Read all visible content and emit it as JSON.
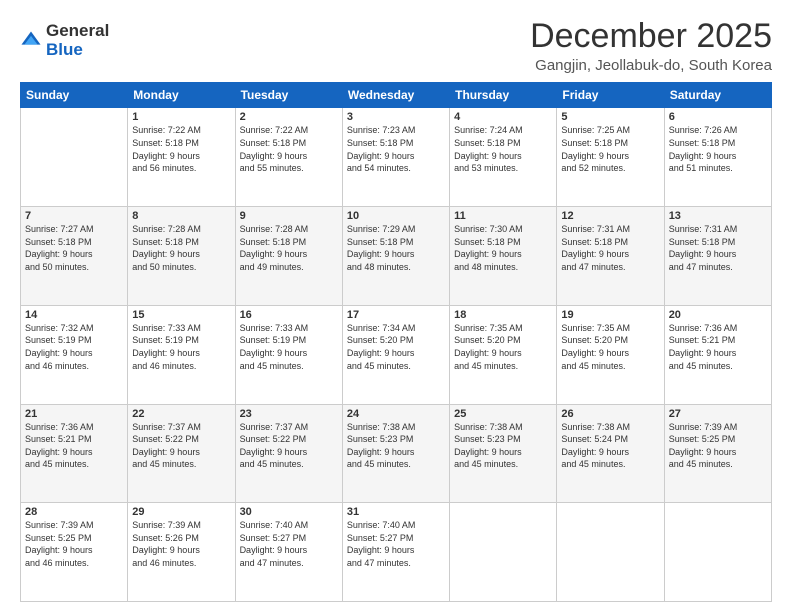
{
  "logo": {
    "general": "General",
    "blue": "Blue"
  },
  "title": "December 2025",
  "subtitle": "Gangjin, Jeollabuk-do, South Korea",
  "days_header": [
    "Sunday",
    "Monday",
    "Tuesday",
    "Wednesday",
    "Thursday",
    "Friday",
    "Saturday"
  ],
  "weeks": [
    [
      {
        "day": "",
        "content": ""
      },
      {
        "day": "1",
        "content": "Sunrise: 7:22 AM\nSunset: 5:18 PM\nDaylight: 9 hours\nand 56 minutes."
      },
      {
        "day": "2",
        "content": "Sunrise: 7:22 AM\nSunset: 5:18 PM\nDaylight: 9 hours\nand 55 minutes."
      },
      {
        "day": "3",
        "content": "Sunrise: 7:23 AM\nSunset: 5:18 PM\nDaylight: 9 hours\nand 54 minutes."
      },
      {
        "day": "4",
        "content": "Sunrise: 7:24 AM\nSunset: 5:18 PM\nDaylight: 9 hours\nand 53 minutes."
      },
      {
        "day": "5",
        "content": "Sunrise: 7:25 AM\nSunset: 5:18 PM\nDaylight: 9 hours\nand 52 minutes."
      },
      {
        "day": "6",
        "content": "Sunrise: 7:26 AM\nSunset: 5:18 PM\nDaylight: 9 hours\nand 51 minutes."
      }
    ],
    [
      {
        "day": "7",
        "content": "Sunrise: 7:27 AM\nSunset: 5:18 PM\nDaylight: 9 hours\nand 50 minutes."
      },
      {
        "day": "8",
        "content": "Sunrise: 7:28 AM\nSunset: 5:18 PM\nDaylight: 9 hours\nand 50 minutes."
      },
      {
        "day": "9",
        "content": "Sunrise: 7:28 AM\nSunset: 5:18 PM\nDaylight: 9 hours\nand 49 minutes."
      },
      {
        "day": "10",
        "content": "Sunrise: 7:29 AM\nSunset: 5:18 PM\nDaylight: 9 hours\nand 48 minutes."
      },
      {
        "day": "11",
        "content": "Sunrise: 7:30 AM\nSunset: 5:18 PM\nDaylight: 9 hours\nand 48 minutes."
      },
      {
        "day": "12",
        "content": "Sunrise: 7:31 AM\nSunset: 5:18 PM\nDaylight: 9 hours\nand 47 minutes."
      },
      {
        "day": "13",
        "content": "Sunrise: 7:31 AM\nSunset: 5:18 PM\nDaylight: 9 hours\nand 47 minutes."
      }
    ],
    [
      {
        "day": "14",
        "content": "Sunrise: 7:32 AM\nSunset: 5:19 PM\nDaylight: 9 hours\nand 46 minutes."
      },
      {
        "day": "15",
        "content": "Sunrise: 7:33 AM\nSunset: 5:19 PM\nDaylight: 9 hours\nand 46 minutes."
      },
      {
        "day": "16",
        "content": "Sunrise: 7:33 AM\nSunset: 5:19 PM\nDaylight: 9 hours\nand 45 minutes."
      },
      {
        "day": "17",
        "content": "Sunrise: 7:34 AM\nSunset: 5:20 PM\nDaylight: 9 hours\nand 45 minutes."
      },
      {
        "day": "18",
        "content": "Sunrise: 7:35 AM\nSunset: 5:20 PM\nDaylight: 9 hours\nand 45 minutes."
      },
      {
        "day": "19",
        "content": "Sunrise: 7:35 AM\nSunset: 5:20 PM\nDaylight: 9 hours\nand 45 minutes."
      },
      {
        "day": "20",
        "content": "Sunrise: 7:36 AM\nSunset: 5:21 PM\nDaylight: 9 hours\nand 45 minutes."
      }
    ],
    [
      {
        "day": "21",
        "content": "Sunrise: 7:36 AM\nSunset: 5:21 PM\nDaylight: 9 hours\nand 45 minutes."
      },
      {
        "day": "22",
        "content": "Sunrise: 7:37 AM\nSunset: 5:22 PM\nDaylight: 9 hours\nand 45 minutes."
      },
      {
        "day": "23",
        "content": "Sunrise: 7:37 AM\nSunset: 5:22 PM\nDaylight: 9 hours\nand 45 minutes."
      },
      {
        "day": "24",
        "content": "Sunrise: 7:38 AM\nSunset: 5:23 PM\nDaylight: 9 hours\nand 45 minutes."
      },
      {
        "day": "25",
        "content": "Sunrise: 7:38 AM\nSunset: 5:23 PM\nDaylight: 9 hours\nand 45 minutes."
      },
      {
        "day": "26",
        "content": "Sunrise: 7:38 AM\nSunset: 5:24 PM\nDaylight: 9 hours\nand 45 minutes."
      },
      {
        "day": "27",
        "content": "Sunrise: 7:39 AM\nSunset: 5:25 PM\nDaylight: 9 hours\nand 45 minutes."
      }
    ],
    [
      {
        "day": "28",
        "content": "Sunrise: 7:39 AM\nSunset: 5:25 PM\nDaylight: 9 hours\nand 46 minutes."
      },
      {
        "day": "29",
        "content": "Sunrise: 7:39 AM\nSunset: 5:26 PM\nDaylight: 9 hours\nand 46 minutes."
      },
      {
        "day": "30",
        "content": "Sunrise: 7:40 AM\nSunset: 5:27 PM\nDaylight: 9 hours\nand 47 minutes."
      },
      {
        "day": "31",
        "content": "Sunrise: 7:40 AM\nSunset: 5:27 PM\nDaylight: 9 hours\nand 47 minutes."
      },
      {
        "day": "",
        "content": ""
      },
      {
        "day": "",
        "content": ""
      },
      {
        "day": "",
        "content": ""
      }
    ]
  ]
}
